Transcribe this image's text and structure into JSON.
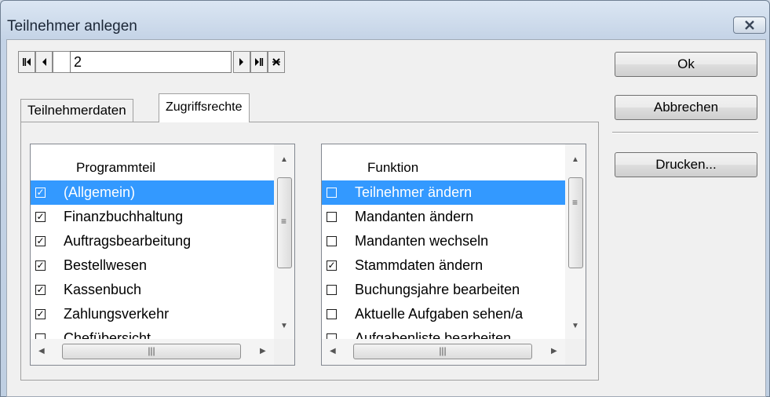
{
  "window": {
    "title": "Teilnehmer anlegen"
  },
  "navigator": {
    "record_value": "2"
  },
  "tabs": [
    {
      "label": "Teilnehmerdaten",
      "active": false
    },
    {
      "label": "Zugriffsrechte",
      "active": true
    }
  ],
  "programmteil": {
    "header": "Programmteil",
    "rows": [
      {
        "label": "(Allgemein)",
        "checked": true,
        "selected": true
      },
      {
        "label": "Finanzbuchhaltung",
        "checked": true,
        "selected": false
      },
      {
        "label": "Auftragsbearbeitung",
        "checked": true,
        "selected": false
      },
      {
        "label": "Bestellwesen",
        "checked": true,
        "selected": false
      },
      {
        "label": "Kassenbuch",
        "checked": true,
        "selected": false
      },
      {
        "label": "Zahlungsverkehr",
        "checked": true,
        "selected": false
      },
      {
        "label": "Chefübersicht",
        "checked": false,
        "selected": false
      }
    ]
  },
  "funktion": {
    "header": "Funktion",
    "rows": [
      {
        "label": "Teilnehmer ändern",
        "checked": false,
        "selected": true
      },
      {
        "label": "Mandanten ändern",
        "checked": false,
        "selected": false
      },
      {
        "label": "Mandanten wechseln",
        "checked": false,
        "selected": false
      },
      {
        "label": "Stammdaten ändern",
        "checked": true,
        "selected": false
      },
      {
        "label": "Buchungsjahre bearbeiten",
        "checked": false,
        "selected": false
      },
      {
        "label": "Aktuelle Aufgaben sehen/a",
        "checked": false,
        "selected": false
      },
      {
        "label": "Aufgabenliste bearbeiten",
        "checked": false,
        "selected": false
      }
    ]
  },
  "buttons": {
    "ok": "Ok",
    "cancel": "Abbrechen",
    "print": "Drucken..."
  },
  "icons": {
    "close": "close-icon",
    "first": "first-record-icon",
    "prev": "prev-record-icon",
    "next": "next-record-icon",
    "last": "last-record-icon",
    "cancel_record": "cancel-record-icon"
  },
  "colors": {
    "selection": "#3399ff",
    "window_frame": "#c4d3e6"
  }
}
